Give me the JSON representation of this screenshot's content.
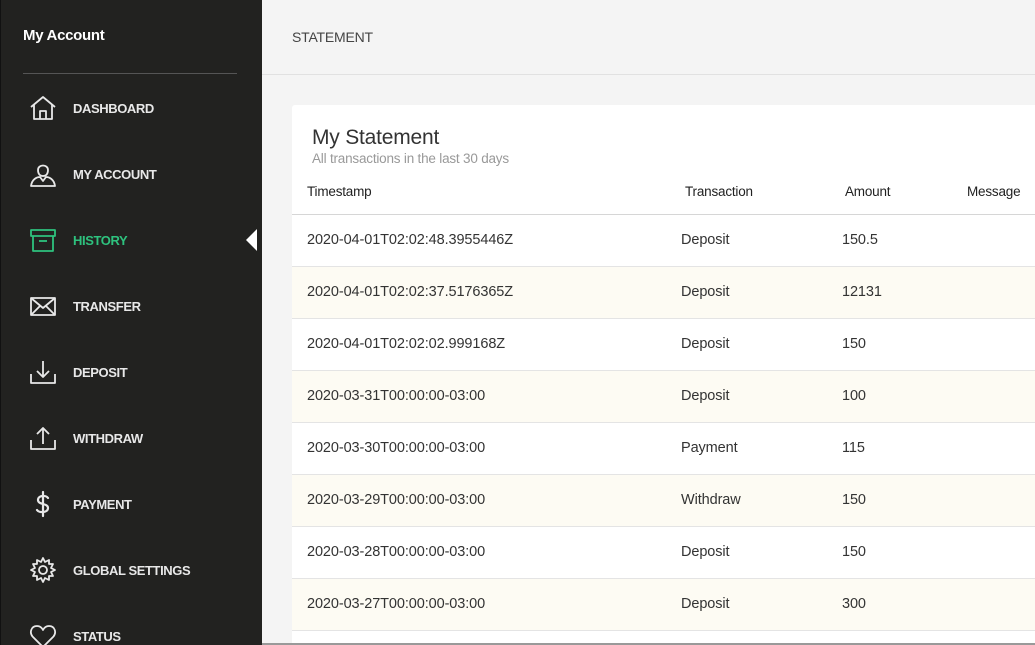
{
  "sidebar": {
    "brand": "My Account",
    "accent_color": "#2ec27e",
    "items": [
      {
        "label": "DASHBOARD",
        "icon": "home-icon"
      },
      {
        "label": "MY ACCOUNT",
        "icon": "user-icon"
      },
      {
        "label": "HISTORY",
        "icon": "archive-icon",
        "active": true
      },
      {
        "label": "TRANSFER",
        "icon": "envelope-icon"
      },
      {
        "label": "DEPOSIT",
        "icon": "download-icon"
      },
      {
        "label": "WITHDRAW",
        "icon": "upload-icon"
      },
      {
        "label": "PAYMENT",
        "icon": "dollar-icon"
      },
      {
        "label": "GLOBAL SETTINGS",
        "icon": "gear-icon"
      },
      {
        "label": "STATUS",
        "icon": "heart-icon"
      }
    ]
  },
  "header": {
    "title": "STATEMENT"
  },
  "statement": {
    "title": "My Statement",
    "subtitle": "All transactions in the last 30 days",
    "columns": [
      "Timestamp",
      "Transaction",
      "Amount",
      "Message"
    ],
    "rows": [
      {
        "timestamp": "2020-04-01T02:02:48.3955446Z",
        "transaction": "Deposit",
        "amount": "150.5",
        "message": ""
      },
      {
        "timestamp": "2020-04-01T02:02:37.5176365Z",
        "transaction": "Deposit",
        "amount": "12131",
        "message": ""
      },
      {
        "timestamp": "2020-04-01T02:02:02.999168Z",
        "transaction": "Deposit",
        "amount": "150",
        "message": ""
      },
      {
        "timestamp": "2020-03-31T00:00:00-03:00",
        "transaction": "Deposit",
        "amount": "100",
        "message": ""
      },
      {
        "timestamp": "2020-03-30T00:00:00-03:00",
        "transaction": "Payment",
        "amount": "115",
        "message": ""
      },
      {
        "timestamp": "2020-03-29T00:00:00-03:00",
        "transaction": "Withdraw",
        "amount": "150",
        "message": ""
      },
      {
        "timestamp": "2020-03-28T00:00:00-03:00",
        "transaction": "Deposit",
        "amount": "150",
        "message": ""
      },
      {
        "timestamp": "2020-03-27T00:00:00-03:00",
        "transaction": "Deposit",
        "amount": "300",
        "message": ""
      }
    ]
  }
}
